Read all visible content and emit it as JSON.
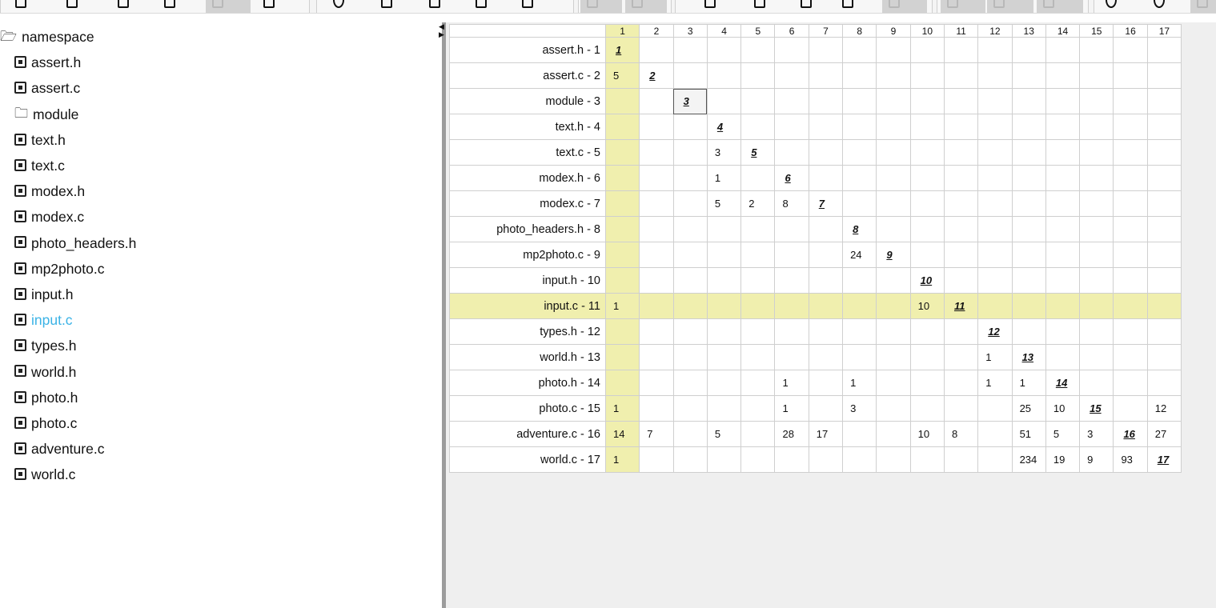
{
  "tree": {
    "root": {
      "label": "namespace",
      "icon": "folder-open-icon"
    },
    "items": [
      {
        "label": "assert.h",
        "icon": "file-icon"
      },
      {
        "label": "assert.c",
        "icon": "file-icon"
      },
      {
        "label": "module",
        "icon": "folder-new-icon"
      },
      {
        "label": "text.h",
        "icon": "file-icon"
      },
      {
        "label": "text.c",
        "icon": "file-icon"
      },
      {
        "label": "modex.h",
        "icon": "file-icon"
      },
      {
        "label": "modex.c",
        "icon": "file-icon"
      },
      {
        "label": "photo_headers.h",
        "icon": "file-icon"
      },
      {
        "label": "mp2photo.c",
        "icon": "file-icon"
      },
      {
        "label": "input.h",
        "icon": "file-icon"
      },
      {
        "label": "input.c",
        "icon": "file-icon",
        "selected": true
      },
      {
        "label": "types.h",
        "icon": "file-icon"
      },
      {
        "label": "world.h",
        "icon": "file-icon"
      },
      {
        "label": "photo.h",
        "icon": "file-icon"
      },
      {
        "label": "photo.c",
        "icon": "file-icon"
      },
      {
        "label": "adventure.c",
        "icon": "file-icon"
      },
      {
        "label": "world.c",
        "icon": "file-icon"
      }
    ]
  },
  "matrix": {
    "columns": [
      "1",
      "2",
      "3",
      "4",
      "5",
      "6",
      "7",
      "8",
      "9",
      "10",
      "11",
      "12",
      "13",
      "14",
      "15",
      "16",
      "17"
    ],
    "highlight_column": 1,
    "highlight_row": 11,
    "highlight_color": "#f0efae",
    "rows": [
      {
        "label": "assert.h - 1",
        "cells": [
          "1",
          "",
          "",
          "",
          "",
          "",
          "",
          "",
          "",
          "",
          "",
          "",
          "",
          "",
          "",
          "",
          ""
        ]
      },
      {
        "label": "assert.c - 2",
        "cells": [
          "5",
          "2",
          "",
          "",
          "",
          "",
          "",
          "",
          "",
          "",
          "",
          "",
          "",
          "",
          "",
          "",
          ""
        ]
      },
      {
        "label": "module - 3",
        "cells": [
          "",
          "",
          "3",
          "",
          "",
          "",
          "",
          "",
          "",
          "",
          "",
          "",
          "",
          "",
          "",
          "",
          ""
        ]
      },
      {
        "label": "text.h - 4",
        "cells": [
          "",
          "",
          "",
          "4",
          "",
          "",
          "",
          "",
          "",
          "",
          "",
          "",
          "",
          "",
          "",
          "",
          ""
        ]
      },
      {
        "label": "text.c - 5",
        "cells": [
          "",
          "",
          "",
          "3",
          "5",
          "",
          "",
          "",
          "",
          "",
          "",
          "",
          "",
          "",
          "",
          "",
          ""
        ]
      },
      {
        "label": "modex.h - 6",
        "cells": [
          "",
          "",
          "",
          "1",
          "",
          "6",
          "",
          "",
          "",
          "",
          "",
          "",
          "",
          "",
          "",
          "",
          ""
        ]
      },
      {
        "label": "modex.c - 7",
        "cells": [
          "",
          "",
          "",
          "5",
          "2",
          "8",
          "7",
          "",
          "",
          "",
          "",
          "",
          "",
          "",
          "",
          "",
          ""
        ]
      },
      {
        "label": "photo_headers.h - 8",
        "cells": [
          "",
          "",
          "",
          "",
          "",
          "",
          "",
          "8",
          "",
          "",
          "",
          "",
          "",
          "",
          "",
          "",
          ""
        ]
      },
      {
        "label": "mp2photo.c - 9",
        "cells": [
          "",
          "",
          "",
          "",
          "",
          "",
          "",
          "24",
          "9",
          "",
          "",
          "",
          "",
          "",
          "",
          "",
          ""
        ]
      },
      {
        "label": "input.h - 10",
        "cells": [
          "",
          "",
          "",
          "",
          "",
          "",
          "",
          "",
          "",
          "10",
          "",
          "",
          "",
          "",
          "",
          "",
          ""
        ]
      },
      {
        "label": "input.c - 11",
        "cells": [
          "1",
          "",
          "",
          "",
          "",
          "",
          "",
          "",
          "",
          "10",
          "11",
          "",
          "",
          "",
          "",
          "",
          ""
        ]
      },
      {
        "label": "types.h - 12",
        "cells": [
          "",
          "",
          "",
          "",
          "",
          "",
          "",
          "",
          "",
          "",
          "",
          "12",
          "",
          "",
          "",
          "",
          ""
        ]
      },
      {
        "label": "world.h - 13",
        "cells": [
          "",
          "",
          "",
          "",
          "",
          "",
          "",
          "",
          "",
          "",
          "",
          "1",
          "13",
          "",
          "",
          "",
          ""
        ]
      },
      {
        "label": "photo.h - 14",
        "cells": [
          "",
          "",
          "",
          "",
          "",
          "1",
          "",
          "1",
          "",
          "",
          "",
          "1",
          "1",
          "14",
          "",
          "",
          ""
        ]
      },
      {
        "label": "photo.c - 15",
        "cells": [
          "1",
          "",
          "",
          "",
          "",
          "1",
          "",
          "3",
          "",
          "",
          "",
          "",
          "25",
          "10",
          "15",
          "",
          "12"
        ]
      },
      {
        "label": "adventure.c - 16",
        "cells": [
          "14",
          "7",
          "",
          "5",
          "",
          "28",
          "17",
          "",
          "",
          "10",
          "8",
          "",
          "51",
          "5",
          "3",
          "16",
          "27"
        ]
      },
      {
        "label": "world.c - 17",
        "cells": [
          "1",
          "",
          "",
          "",
          "",
          "",
          "",
          "",
          "",
          "",
          "",
          "",
          "234",
          "19",
          "9",
          "93",
          "17"
        ]
      }
    ]
  }
}
